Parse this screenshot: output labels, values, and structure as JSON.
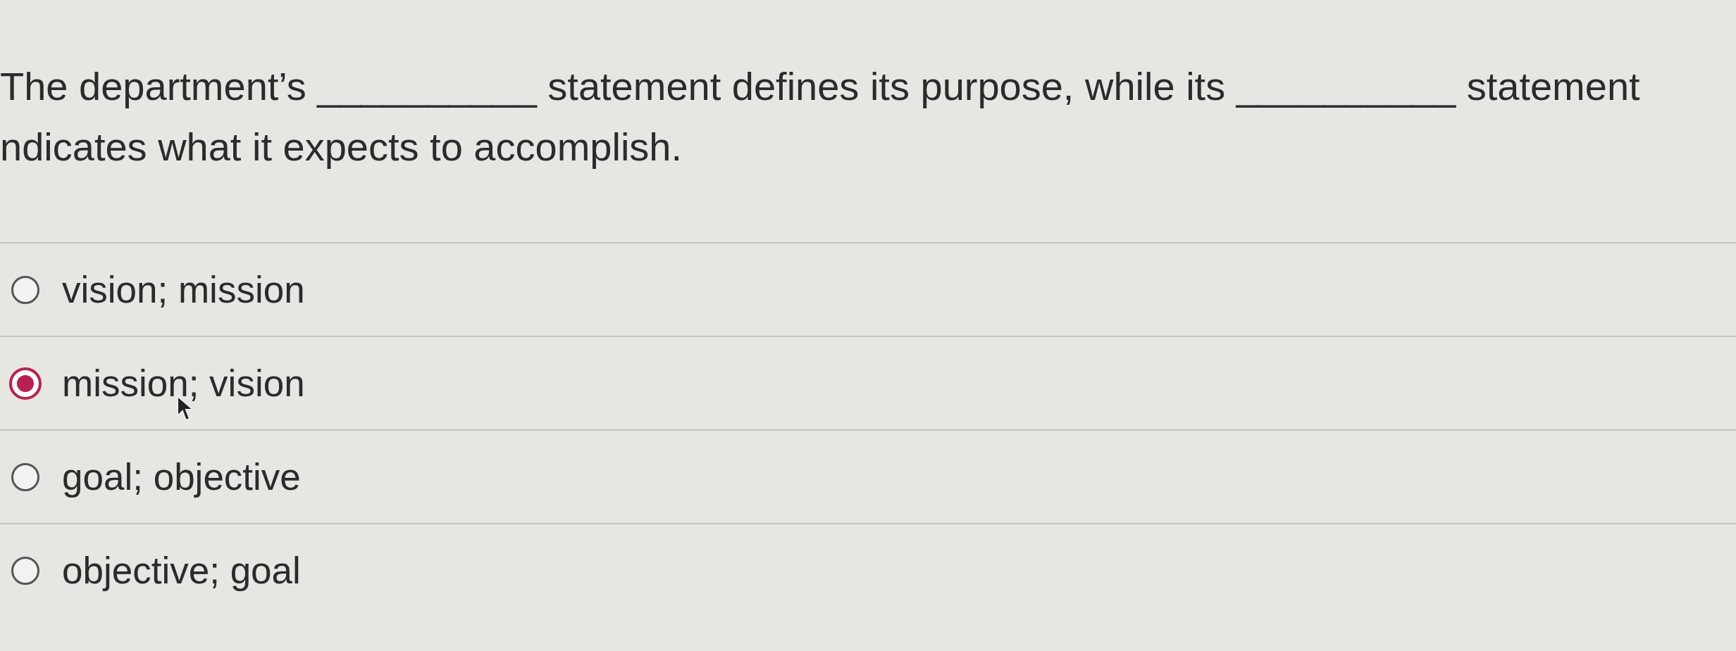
{
  "question": {
    "text": "The department’s __________ statement defines its purpose, while its __________ statement ndicates what it expects to accomplish."
  },
  "options": [
    {
      "label": "vision; mission",
      "selected": false
    },
    {
      "label": "mission; vision",
      "selected": true
    },
    {
      "label": "goal; objective",
      "selected": false
    },
    {
      "label": "objective; goal",
      "selected": false
    }
  ]
}
